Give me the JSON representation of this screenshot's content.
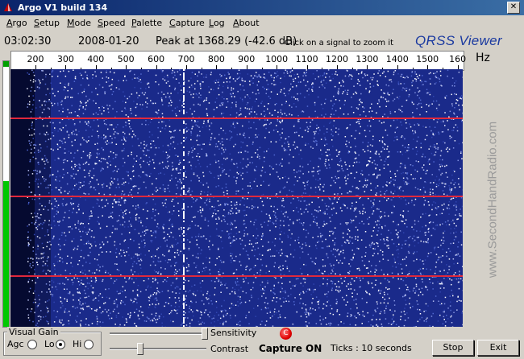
{
  "window": {
    "title": "Argo V1 build 134",
    "close_glyph": "✕"
  },
  "menu": [
    {
      "key": "A",
      "rest": "rgo"
    },
    {
      "key": "S",
      "rest": "etup"
    },
    {
      "key": "M",
      "rest": "ode"
    },
    {
      "key": "S",
      "rest": "peed"
    },
    {
      "key": "P",
      "rest": "alette"
    },
    {
      "key": "C",
      "rest": "apture"
    },
    {
      "key": "L",
      "rest": "og"
    },
    {
      "key": "A",
      "rest": "bout"
    }
  ],
  "info": {
    "time": "03:02:30",
    "date": "2008-01-20",
    "peak": "Peak at 1368.29 (-42.6 dB)",
    "hint": "Click on a signal to zoom it",
    "brand": "QRSS Viewer"
  },
  "scale": {
    "labels": [
      "200",
      "300",
      "400",
      "500",
      "600",
      "700",
      "800",
      "900",
      "1000",
      "1100",
      "1200",
      "1300",
      "1400",
      "1500",
      "160"
    ],
    "unit": "Hz"
  },
  "watermark": "www.SecondHandRadio.com",
  "controls": {
    "visual_gain_title": "Visual Gain",
    "agc_label": "Agc",
    "lo_label": "Lo",
    "hi_label": "Hi",
    "selected": "lo",
    "sensitivity_label": "Sensitivity",
    "contrast_label": "Contrast",
    "sensitivity_level": 1.0,
    "contrast_level": 0.3,
    "capture_led_glyph": "C",
    "capture_status": "Capture ON",
    "ticks": "Ticks  : 10 seconds",
    "stop_label": "Stop",
    "exit_label": "Exit"
  },
  "meter": {
    "level": 0.55
  },
  "colors": {
    "titlebar_start": "#0a246a",
    "waterfall_base": "#1a2a8a",
    "marker_line": "#e0283c",
    "signal": "#ffffff"
  }
}
